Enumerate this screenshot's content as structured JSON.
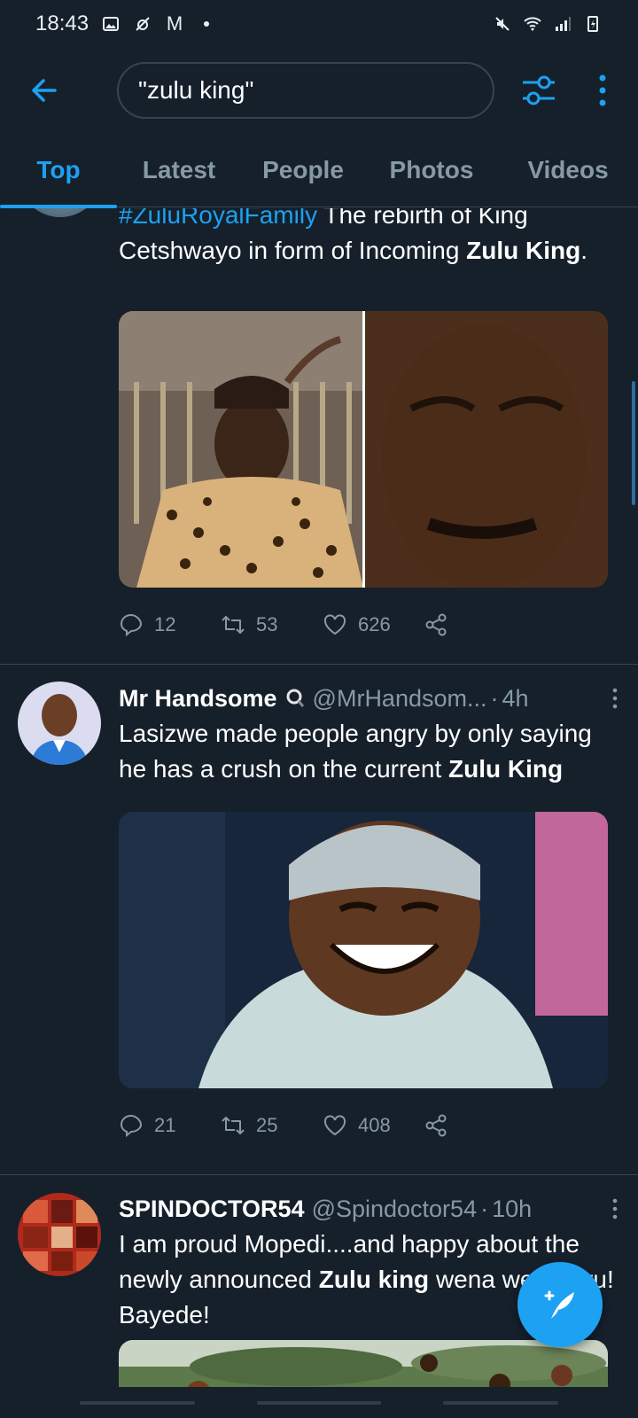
{
  "status_bar": {
    "time": "18:43",
    "mail_icon_glyph": "M"
  },
  "search": {
    "query": "\"zulu king\""
  },
  "tabs": [
    {
      "label": "Top",
      "active": true
    },
    {
      "label": "Latest",
      "active": false
    },
    {
      "label": "People",
      "active": false
    },
    {
      "label": "Photos",
      "active": false
    },
    {
      "label": "Videos",
      "active": false
    }
  ],
  "tweets": [
    {
      "hashtag": "#ZuluRoyalFamily",
      "text_1": " The rebirth of King Cetshwayo in form of Incoming ",
      "bold_1": "Zulu King",
      "text_2": ".",
      "replies": "12",
      "retweets": "53",
      "likes": "626"
    },
    {
      "name": "Mr Handsome",
      "handle": "@MrHandsom...",
      "time": "4h",
      "text_1": "Lasizwe made people angry by only saying he has a crush on the current ",
      "bold_1": "Zulu King",
      "replies": "21",
      "retweets": "25",
      "likes": "408"
    },
    {
      "name": "SPINDOCTOR54",
      "handle": "@Spindoctor54",
      "time": "10h",
      "text_1": "I am proud Mopedi....and happy about the newly announced ",
      "bold_1": "Zulu king",
      "text_2": " wena wendlovu! Bayede!"
    }
  ],
  "colors": {
    "accent": "#1da1f2",
    "background": "#15202b",
    "secondary_text": "#8899a6",
    "divider": "#38444d"
  },
  "icons": [
    "back-arrow-icon",
    "filter-sliders-icon",
    "more-vertical-icon",
    "reply-icon",
    "retweet-icon",
    "like-icon",
    "share-icon",
    "compose-feather-icon"
  ]
}
